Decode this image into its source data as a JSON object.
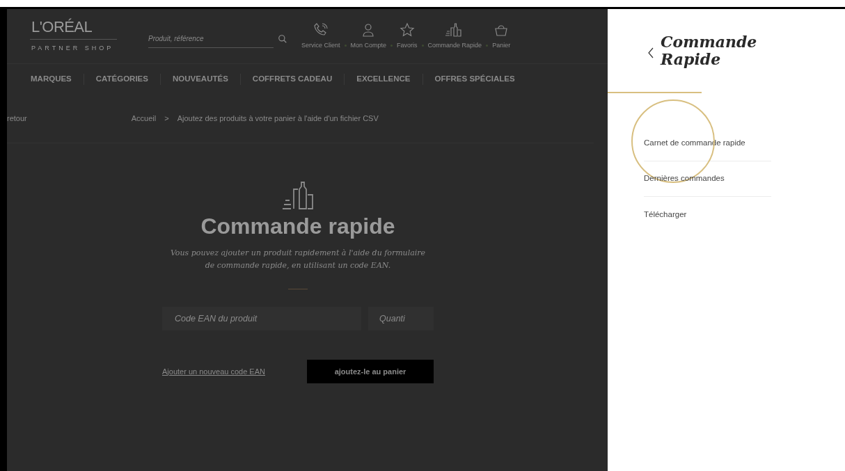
{
  "header": {
    "logo": {
      "brand": "L'ORÉAL",
      "sub": "PARTNER SHOP"
    },
    "search": {
      "placeholder": "Produit, référence"
    },
    "shortcuts": [
      {
        "kind": "phone",
        "label": "Service Client"
      },
      {
        "kind": "user",
        "label": "Mon Compte"
      },
      {
        "kind": "star",
        "label": "Favoris"
      },
      {
        "kind": "products",
        "label": "Commande Rapide"
      },
      {
        "kind": "basket",
        "label": "Panier"
      }
    ]
  },
  "nav": [
    "MARQUES",
    "CATÉGORIES",
    "NOUVEAUTÉS",
    "COFFRETS CADEAU",
    "EXCELLENCE",
    "OFFRES SPÉCIALES"
  ],
  "back_link": "retour",
  "breadcrumb": [
    "Accueil",
    "Ajoutez des produits à votre panier à l'aide d'un fichier CSV"
  ],
  "breadcrumb_separator": ">",
  "main": {
    "title": "Commande rapide",
    "subtitle": "Vous pouvez ajouter un produit rapidement à l'aide du formulaire de commande rapide, en utilisant un code EAN.",
    "ean_field": {
      "placeholder": "Code EAN du produit"
    },
    "qty_field": {
      "placeholder": "Quanti"
    },
    "add_link": "Ajouter un nouveau code EAN",
    "submit": "ajoutez-le au panier"
  },
  "panel": {
    "title_lines": [
      "Commande",
      "Rapide"
    ],
    "items": [
      {
        "label": "Carnet de commande rapide",
        "highlighted": true
      },
      {
        "label": "Dernières commandes",
        "highlighted": false
      },
      {
        "label": "Télécharger",
        "highlighted": false
      }
    ]
  }
}
